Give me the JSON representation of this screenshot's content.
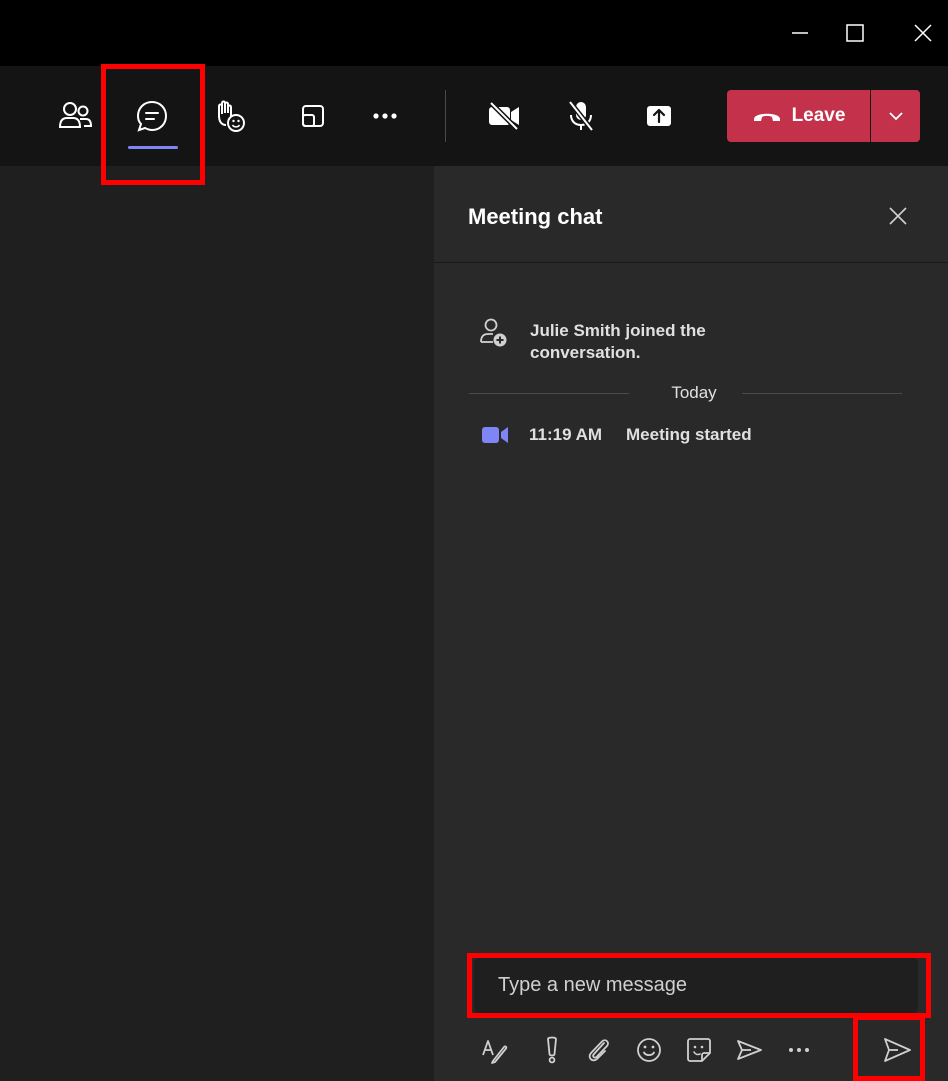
{
  "titlebar": {
    "buttons": [
      "minimize-icon",
      "maximize-icon",
      "close-icon"
    ]
  },
  "toolbar": {
    "buttons": [
      "participants-icon",
      "chat-icon",
      "react-raise-hand-icon",
      "rooms-icon",
      "more-icon",
      "camera-off-icon",
      "mic-off-icon",
      "share-icon"
    ],
    "leave_label": "Leave"
  },
  "chat": {
    "title": "Meeting chat",
    "system_message": "Julie Smith joined the conversation.",
    "divider_label": "Today",
    "meeting_event": {
      "time": "11:19 AM",
      "text": "Meeting started"
    },
    "input_placeholder": "Type a new message",
    "compose_tools": [
      "format-icon",
      "priority-icon",
      "attach-icon",
      "emoji-icon",
      "sticker-icon",
      "loop-icon",
      "more-options-icon"
    ],
    "send_icon": "send-icon"
  },
  "colors": {
    "titlebar": "#000000",
    "toolbar": "#141414",
    "stage": "#1f1f1f",
    "panel": "#292929",
    "leave": "#c4314b",
    "accent": "#7f85f5",
    "highlight": "#ff0000"
  }
}
